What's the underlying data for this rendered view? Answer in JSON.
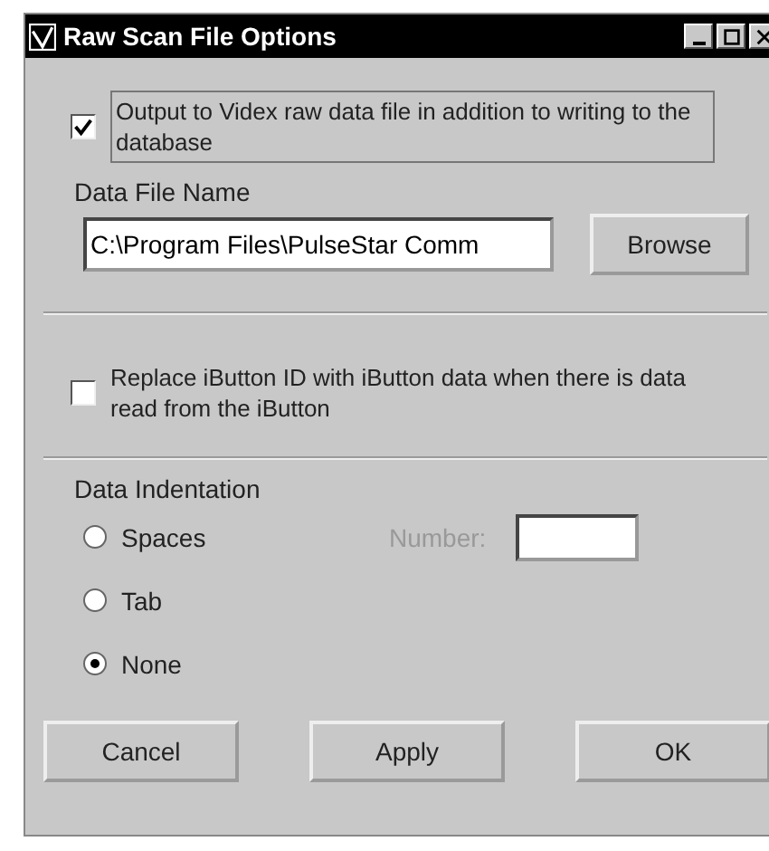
{
  "window": {
    "title": "Raw Scan File Options"
  },
  "output_option": {
    "label": "Output to Videx raw data file in addition to writing to the database",
    "checked": true
  },
  "data_file": {
    "heading": "Data File Name",
    "value": "C:\\Program Files\\PulseStar Comm",
    "browse": "Browse"
  },
  "replace_option": {
    "label": "Replace iButton ID with iButton data when there is data read from the iButton",
    "checked": false
  },
  "indentation": {
    "heading": "Data Indentation",
    "options": [
      {
        "label": "Spaces",
        "selected": false
      },
      {
        "label": "Tab",
        "selected": false
      },
      {
        "label": "None",
        "selected": true
      }
    ],
    "number": {
      "label": "Number:",
      "disabled": true
    }
  },
  "buttons": [
    "Cancel",
    "Apply",
    "OK"
  ]
}
